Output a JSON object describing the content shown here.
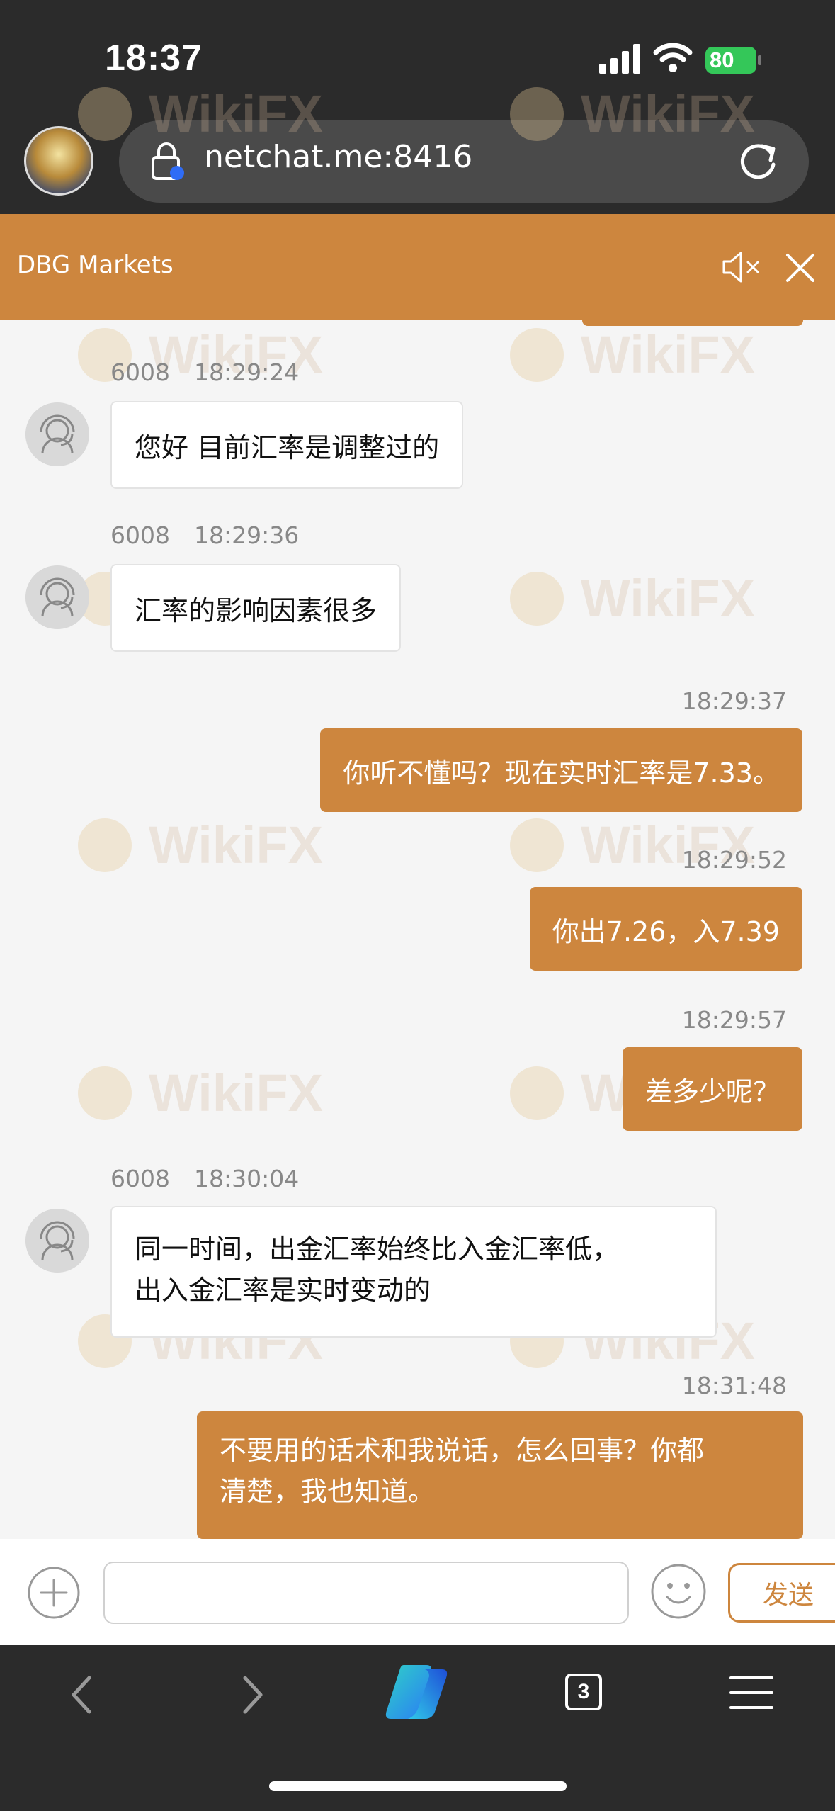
{
  "status_bar": {
    "time": "18:37",
    "battery": "80"
  },
  "browser": {
    "url": "netchat.me:8416",
    "tab_count": "3"
  },
  "chat": {
    "title": "DBG Markets",
    "messages": [
      {
        "sender": "6008",
        "time": "18:29:24",
        "text": "您好 目前汇率是调整过的"
      },
      {
        "sender": "6008",
        "time": "18:29:36",
        "text": "汇率的影响因素很多"
      },
      {
        "time": "18:29:37",
        "text": "你听不懂吗？现在实时汇率是7.33。"
      },
      {
        "time": "18:29:52",
        "text": "你出7.26，入7.39"
      },
      {
        "time": "18:29:57",
        "text": "差多少呢？"
      },
      {
        "sender": "6008",
        "time": "18:30:04",
        "lines": [
          "同一时间，出金汇率始终比入金汇率低，",
          "出入金汇率是实时变动的"
        ]
      },
      {
        "time": "18:31:48",
        "lines": [
          "不要用的话术和我说话，怎么回事？你都",
          "清楚，我也知道。"
        ]
      }
    ]
  },
  "composer": {
    "send_label": "发送"
  },
  "watermark": "WikiFX",
  "colors": {
    "accent": "#cd863e",
    "browser_chrome": "#2b2b2b",
    "battery_green": "#34c759"
  },
  "icons": [
    "signal-icon",
    "wifi-icon",
    "battery-icon",
    "lock-icon",
    "reload-icon",
    "mute-icon",
    "close-icon",
    "agent-avatar-icon",
    "plus-icon",
    "emoji-icon",
    "back-icon",
    "forward-icon",
    "copilot-icon",
    "tabs-icon",
    "menu-icon"
  ]
}
